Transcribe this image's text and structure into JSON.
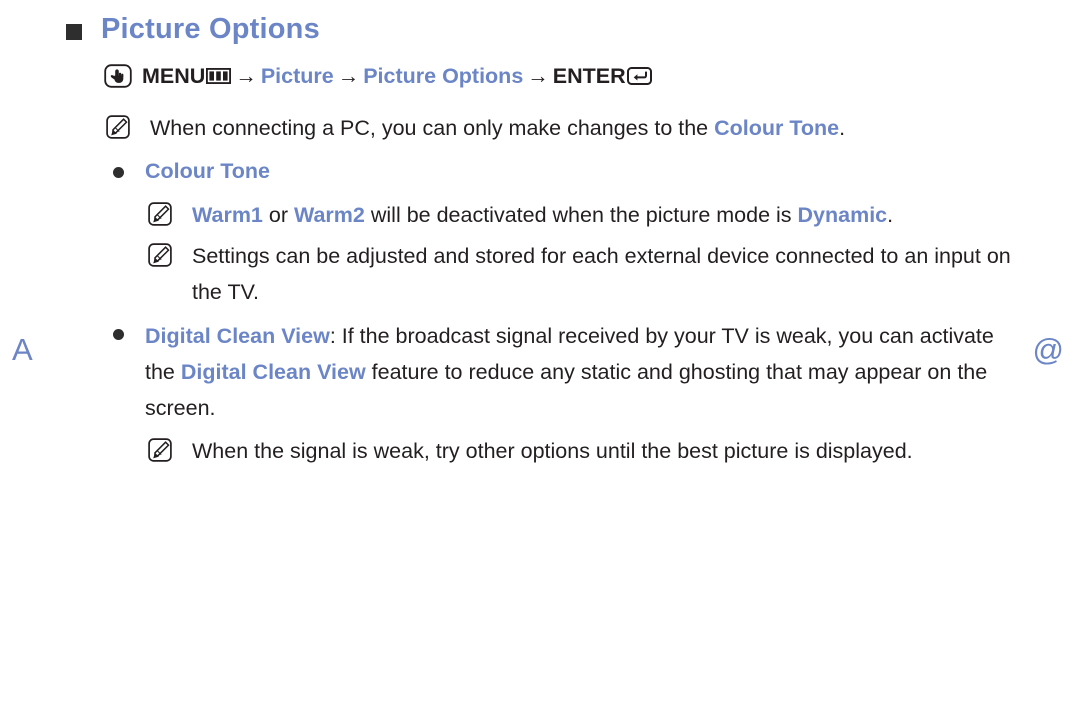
{
  "page": {
    "margin_left_mark": "A",
    "margin_right_mark": "@"
  },
  "title": {
    "text": "Picture Options",
    "bullet_icon": "square-bullet-icon",
    "color": "#6b85c6"
  },
  "menu_path": {
    "oo_icon": "oo-hand-press-icon",
    "menu_label": "MENU",
    "menu_icon": "menu-box-icon",
    "arrow": "→",
    "step1": "Picture",
    "step2": "Picture Options",
    "enter_label": "ENTER",
    "enter_icon": "enter-key-icon"
  },
  "notes": {
    "note1": {
      "icon": "note-pencil-icon",
      "text_before": "When connecting a PC, you can only make changes to the ",
      "highlight": "Colour Tone",
      "text_after": "."
    },
    "note2": {
      "icon": "note-pencil-icon",
      "highlight1": "Warm1",
      "mid1": " or ",
      "highlight2": "Warm2",
      "mid2": " will be deactivated when the picture mode is ",
      "highlight3": "Dynamic",
      "text_after": "."
    },
    "note3": {
      "icon": "note-pencil-icon",
      "text": "Settings can be adjusted and stored for each external device connected to an input on the TV."
    },
    "note4": {
      "icon": "note-pencil-icon",
      "text": "When the signal is weak, try other options until the best picture is displayed."
    }
  },
  "bullets": {
    "bullet1": {
      "icon": "round-bullet-icon",
      "label": "Colour Tone"
    },
    "bullet2": {
      "icon": "round-bullet-icon",
      "label": "Digital Clean View",
      "text_after_label": ": If the broadcast signal received by your TV is weak, you can activate the ",
      "highlight2": "Digital Clean View",
      "text_tail": " feature to reduce any static and ghosting that may appear on the screen."
    }
  },
  "colors": {
    "accent_blue": "#6b85c6",
    "body_black": "#231f20",
    "bullet_dark": "#2e2e2e"
  }
}
